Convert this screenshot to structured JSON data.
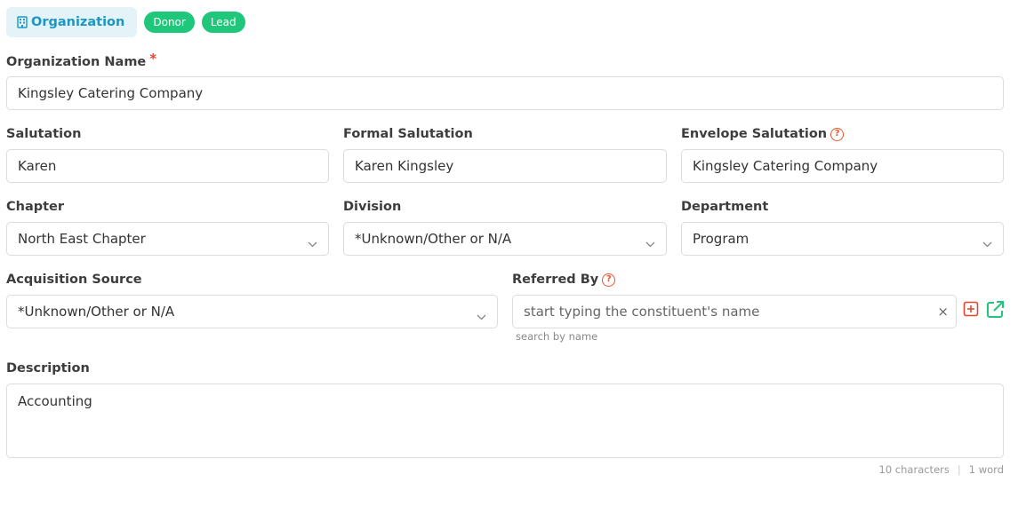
{
  "header": {
    "type_icon": "building-icon",
    "type_label": "Organization",
    "badges": [
      "Donor",
      "Lead"
    ]
  },
  "organization_name": {
    "label": "Organization Name",
    "required_mark": "*",
    "value": "Kingsley Catering Company"
  },
  "salutation": {
    "label": "Salutation",
    "value": "Karen"
  },
  "formal_salutation": {
    "label": "Formal Salutation",
    "value": "Karen Kingsley"
  },
  "envelope_salutation": {
    "label": "Envelope Salutation",
    "help_icon": "question-circle-icon",
    "help_glyph": "?",
    "value": "Kingsley Catering Company"
  },
  "chapter": {
    "label": "Chapter",
    "value": "North East Chapter"
  },
  "division": {
    "label": "Division",
    "value": "*Unknown/Other or N/A"
  },
  "department": {
    "label": "Department",
    "value": "Program"
  },
  "acquisition_source": {
    "label": "Acquisition Source",
    "value": "*Unknown/Other or N/A"
  },
  "referred_by": {
    "label": "Referred By",
    "help_glyph": "?",
    "placeholder": "start typing the constituent's name",
    "clear_glyph": "×",
    "hint": "search by name",
    "add_icon": "plus-square-icon",
    "open_icon": "external-link-icon"
  },
  "description": {
    "label": "Description",
    "value": "Accounting",
    "char_count": "10 characters",
    "separator": "|",
    "word_count": "1 word"
  },
  "colors": {
    "accent": "#1a97c4",
    "badge": "#1ec77a",
    "required": "#e8452f",
    "border": "#d9dde2"
  }
}
